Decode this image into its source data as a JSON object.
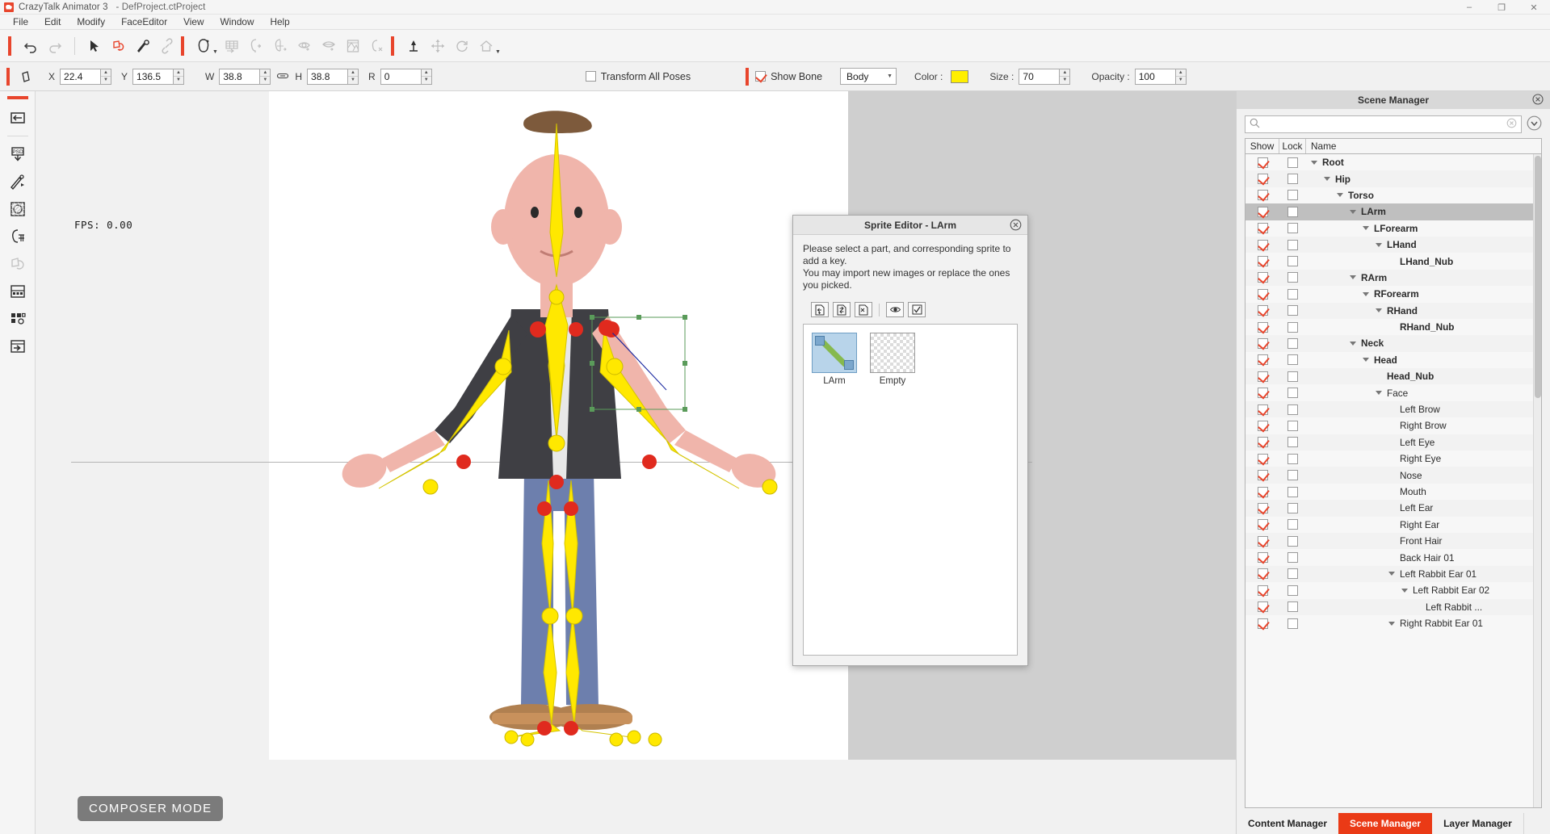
{
  "window": {
    "title": "CrazyTalk Animator 3",
    "document": "- DefProject.ctProject",
    "minimize": "–",
    "maximize": "❐",
    "close": "✕"
  },
  "menubar": {
    "items": [
      "File",
      "Edit",
      "Modify",
      "FaceEditor",
      "View",
      "Window",
      "Help"
    ]
  },
  "toolbar": {
    "icons": [
      "undo-icon",
      "redo-icon",
      "select-arrow-icon",
      "transform-hand-icon",
      "bone-edit-icon",
      "link-icon",
      "face-puppet-icon",
      "grid-face-icon",
      "head-profile-icon",
      "head-pin-icon",
      "eye-edit-icon",
      "mouth-edit-icon",
      "texture-edit-icon",
      "head-remove-icon",
      "pin-tool-icon",
      "move-tool-icon",
      "rotate-tool-icon",
      "home-tool-icon"
    ]
  },
  "propbar": {
    "x_label": "X",
    "x_value": "22.4",
    "y_label": "Y",
    "y_value": "136.5",
    "w_label": "W",
    "w_value": "38.8",
    "h_label": "H",
    "h_value": "38.8",
    "r_label": "R",
    "r_value": "0",
    "transform_all_poses": "Transform All Poses",
    "transform_all_poses_checked": false,
    "show_bone": "Show Bone",
    "show_bone_checked": true,
    "bone_target": "Body",
    "color_label": "Color :",
    "color_value": "#FFEF00",
    "size_label": "Size :",
    "size_value": "70",
    "opacity_label": "Opacity :",
    "opacity_value": "100"
  },
  "left_toolbar": {
    "icons": [
      "import-layer-icon",
      "psd-import-icon",
      "bone-pen-icon",
      "mesh-icon",
      "head-grid-icon",
      "flip-icon-disabled",
      "sprite-table-icon",
      "sprite-grid-icon",
      "export-icon"
    ]
  },
  "viewport": {
    "fps": "FPS: 0.00",
    "mode_badge": "COMPOSER MODE"
  },
  "sprite_dialog": {
    "title": "Sprite Editor - LArm",
    "description_line1": "Please select a part, and corresponding sprite to add a key.",
    "description_line2": "You may import new images or replace the ones you picked.",
    "tools": [
      "add-sprite-icon",
      "replace-sprite-icon",
      "remove-sprite-icon",
      "preview-eye-icon",
      "apply-check-icon"
    ],
    "sprites": [
      {
        "label": "LArm",
        "selected": true,
        "type": "image"
      },
      {
        "label": "Empty",
        "selected": false,
        "type": "empty"
      }
    ]
  },
  "scene_manager": {
    "title": "Scene Manager",
    "close_icon": "close-circle-icon",
    "search_placeholder": "",
    "search_value": "",
    "search_icon": "search-icon",
    "clear_icon": "clear-circle-icon",
    "filter_icon": "chevron-down-circle-icon",
    "columns": [
      "Show",
      "Lock",
      "Name"
    ],
    "tree": [
      {
        "name": "Root",
        "depth": 0,
        "expand": true,
        "bold": true,
        "show": true,
        "lock": false,
        "selected": false
      },
      {
        "name": "Hip",
        "depth": 1,
        "expand": true,
        "bold": true,
        "show": true,
        "lock": false,
        "selected": false
      },
      {
        "name": "Torso",
        "depth": 2,
        "expand": true,
        "bold": true,
        "show": true,
        "lock": false,
        "selected": false
      },
      {
        "name": "LArm",
        "depth": 3,
        "expand": true,
        "bold": true,
        "show": true,
        "lock": false,
        "selected": true
      },
      {
        "name": "LForearm",
        "depth": 4,
        "expand": true,
        "bold": true,
        "show": true,
        "lock": false,
        "selected": false
      },
      {
        "name": "LHand",
        "depth": 5,
        "expand": true,
        "bold": true,
        "show": true,
        "lock": false,
        "selected": false
      },
      {
        "name": "LHand_Nub",
        "depth": 6,
        "expand": false,
        "bold": true,
        "show": true,
        "lock": false,
        "selected": false
      },
      {
        "name": "RArm",
        "depth": 3,
        "expand": true,
        "bold": true,
        "show": true,
        "lock": false,
        "selected": false
      },
      {
        "name": "RForearm",
        "depth": 4,
        "expand": true,
        "bold": true,
        "show": true,
        "lock": false,
        "selected": false
      },
      {
        "name": "RHand",
        "depth": 5,
        "expand": true,
        "bold": true,
        "show": true,
        "lock": false,
        "selected": false
      },
      {
        "name": "RHand_Nub",
        "depth": 6,
        "expand": false,
        "bold": true,
        "show": true,
        "lock": false,
        "selected": false
      },
      {
        "name": "Neck",
        "depth": 3,
        "expand": true,
        "bold": true,
        "show": true,
        "lock": false,
        "selected": false
      },
      {
        "name": "Head",
        "depth": 4,
        "expand": true,
        "bold": true,
        "show": true,
        "lock": false,
        "selected": false
      },
      {
        "name": "Head_Nub",
        "depth": 5,
        "expand": false,
        "bold": true,
        "show": true,
        "lock": false,
        "selected": false
      },
      {
        "name": "Face",
        "depth": 5,
        "expand": true,
        "bold": false,
        "show": true,
        "lock": false,
        "selected": false
      },
      {
        "name": "Left Brow",
        "depth": 6,
        "expand": false,
        "bold": false,
        "show": true,
        "lock": false,
        "selected": false
      },
      {
        "name": "Right Brow",
        "depth": 6,
        "expand": false,
        "bold": false,
        "show": true,
        "lock": false,
        "selected": false
      },
      {
        "name": "Left Eye",
        "depth": 6,
        "expand": false,
        "bold": false,
        "show": true,
        "lock": false,
        "selected": false
      },
      {
        "name": "Right Eye",
        "depth": 6,
        "expand": false,
        "bold": false,
        "show": true,
        "lock": false,
        "selected": false
      },
      {
        "name": "Nose",
        "depth": 6,
        "expand": false,
        "bold": false,
        "show": true,
        "lock": false,
        "selected": false
      },
      {
        "name": "Mouth",
        "depth": 6,
        "expand": false,
        "bold": false,
        "show": true,
        "lock": false,
        "selected": false
      },
      {
        "name": "Left Ear",
        "depth": 6,
        "expand": false,
        "bold": false,
        "show": true,
        "lock": false,
        "selected": false
      },
      {
        "name": "Right Ear",
        "depth": 6,
        "expand": false,
        "bold": false,
        "show": true,
        "lock": false,
        "selected": false
      },
      {
        "name": "Front Hair",
        "depth": 6,
        "expand": false,
        "bold": false,
        "show": true,
        "lock": false,
        "selected": false
      },
      {
        "name": "Back Hair 01",
        "depth": 6,
        "expand": false,
        "bold": false,
        "show": true,
        "lock": false,
        "selected": false
      },
      {
        "name": "Left Rabbit Ear 01",
        "depth": 6,
        "expand": true,
        "bold": false,
        "show": true,
        "lock": false,
        "selected": false
      },
      {
        "name": "Left Rabbit Ear 02",
        "depth": 7,
        "expand": true,
        "bold": false,
        "show": true,
        "lock": false,
        "selected": false
      },
      {
        "name": "Left Rabbit ...",
        "depth": 8,
        "expand": false,
        "bold": false,
        "show": true,
        "lock": false,
        "selected": false
      },
      {
        "name": "Right Rabbit Ear 01",
        "depth": 6,
        "expand": true,
        "bold": false,
        "show": true,
        "lock": false,
        "selected": false
      }
    ],
    "tabs": [
      {
        "label": "Content Manager",
        "active": false
      },
      {
        "label": "Scene Manager",
        "active": true
      },
      {
        "label": "Layer Manager",
        "active": false
      }
    ],
    "accent_color": "#EA3A16"
  }
}
